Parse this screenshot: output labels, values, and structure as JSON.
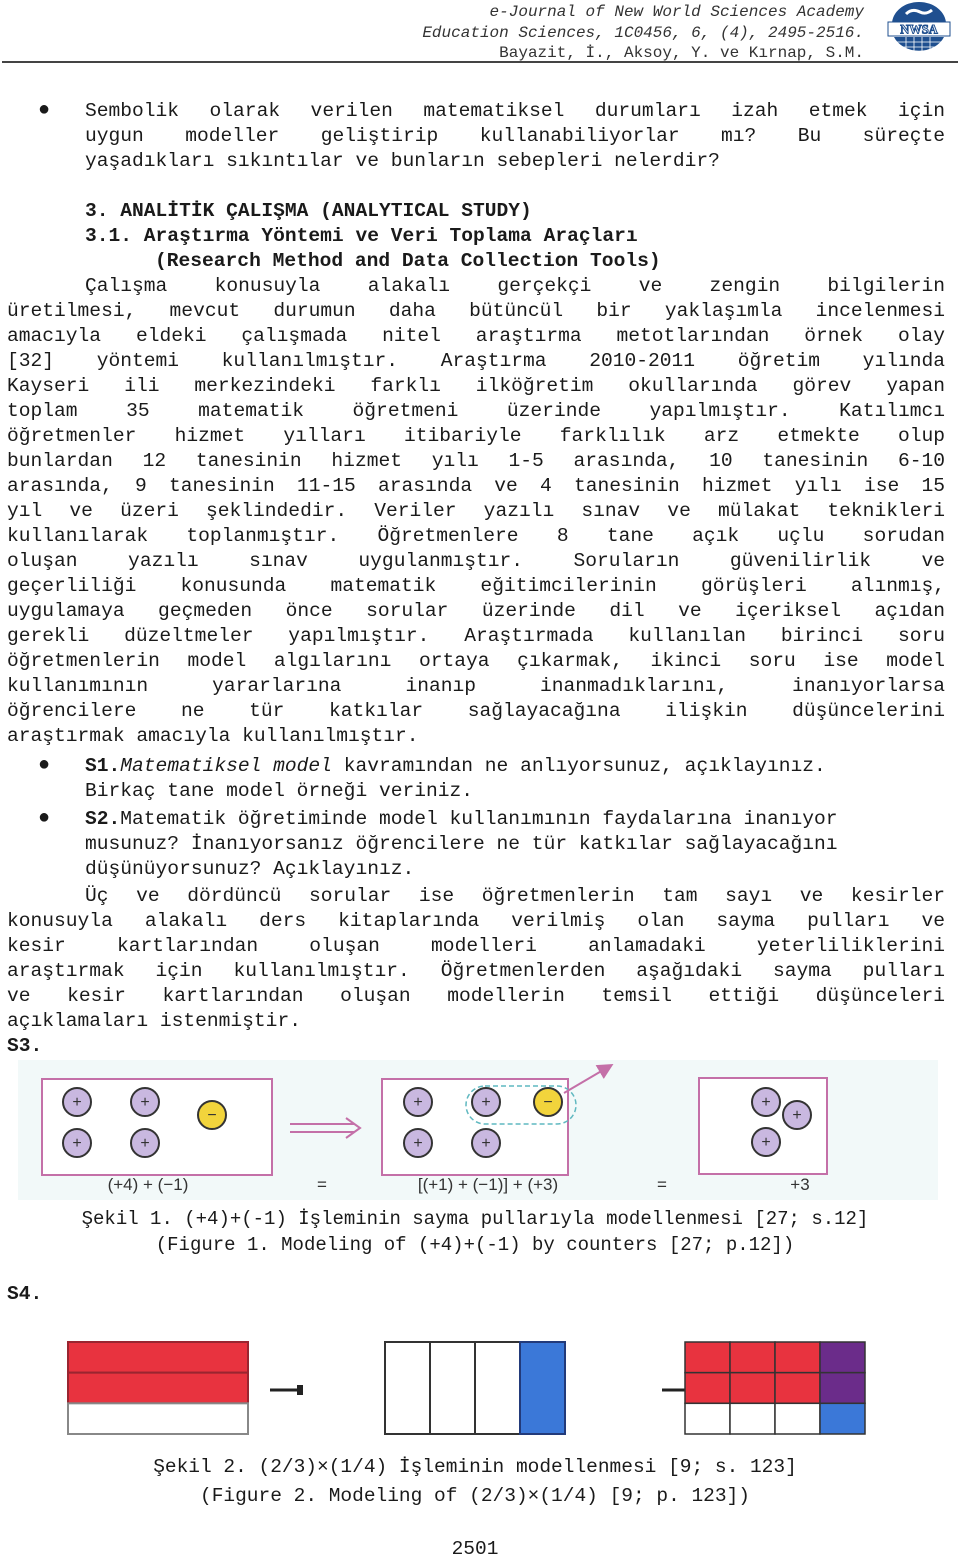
{
  "header": {
    "journal_line": "e-Journal of New World Sciences Academy",
    "citation_line": "Education Sciences, 1C0456, 6, (4), 2495-2516.",
    "authors_line": "Bayazit, İ., Aksoy, Y. ve Kırnap, S.M.",
    "logo_text": "NWSA",
    "logo_icon": "nwsa-globe-logo"
  },
  "intro_bullet": {
    "lines": [
      "Sembolik olarak verilen matematiksel durumları izah etmek için",
      "uygun modeller geliştirip kullanabiliyorlar mı? Bu süreçte",
      "yaşadıkları sıkıntılar ve bunların sebepleri nelerdir?"
    ]
  },
  "section": {
    "heading": "3. ANALİTİK ÇALIŞMA (ANALYTICAL STUDY)",
    "subheading": "3.1. Araştırma Yöntemi ve Veri Toplama Araçları",
    "subheading_en": "(Research Method and Data Collection Tools)"
  },
  "paragraph1": {
    "lines": [
      "Çalışma konusuyla alakalı gerçekçi ve zengin bilgilerin",
      "üretilmesi, mevcut durumun daha bütüncül bir yaklaşımla incelenmesi",
      "amacıyla eldeki çalışmada nitel araştırma metotlarından örnek olay",
      "[32] yöntemi kullanılmıştır. Araştırma 2010-2011 öğretim yılında",
      "Kayseri ili merkezindeki farklı ilköğretim okullarında görev yapan",
      "toplam 35 matematik öğretmeni üzerinde yapılmıştır. Katılımcı",
      "öğretmenler hizmet yılları itibariyle farklılık arz etmekte olup",
      "bunlardan 12 tanesinin hizmet yılı 1-5 arasında, 10 tanesinin 6-10",
      "arasında, 9 tanesinin 11-15 arasında ve 4 tanesinin hizmet yılı ise 15",
      "yıl ve üzeri şeklindedir. Veriler yazılı sınav ve mülakat teknikleri",
      "kullanılarak toplanmıştır. Öğretmenlere 8 tane açık uçlu sorudan",
      "oluşan yazılı sınav uygulanmıştır. Soruların güvenilirlik ve",
      "geçerliliği konusunda matematik eğitimcilerinin görüşleri alınmış,",
      "uygulamaya geçmeden önce sorular üzerinde dil ve içeriksel açıdan",
      "gerekli düzeltmeler yapılmıştır. Araştırmada kullanılan birinci soru",
      "öğretmenlerin model algılarını ortaya çıkarmak, ikinci soru ise model",
      "kullanımının yararlarına inanıp inanmadıklarını, inanıyorlarsa",
      "öğrencilere ne tür katkılar sağlayacağına ilişkin düşüncelerini",
      "araştırmak amacıyla kullanılmıştır."
    ]
  },
  "questions": [
    {
      "label": "S1.",
      "italic_part": "Matematiksel model",
      "rest_line1": " kavramından ne anlıyorsunuz, açıklayınız.",
      "line2": "Birkaç tane model örneği veriniz."
    },
    {
      "label": "S2.",
      "rest_line1": "Matematik öğretiminde model kullanımının faydalarına inanıyor",
      "line2": "musunuz? İnanıyorsanız öğrencilere ne tür katkılar sağlayacağını",
      "line3": "düşünüyorsunuz? Açıklayınız."
    }
  ],
  "paragraph2": {
    "lines": [
      "Üç ve dördüncü sorular ise öğretmenlerin tam sayı ve kesirler",
      "konusuyla alakalı ders kitaplarında verilmiş olan sayma pulları ve",
      "kesir kartlarından oluşan modelleri anlamadaki yeterliliklerini",
      "araştırmak için kullanılmıştır. Öğretmenlerden aşağıdaki sayma pulları",
      "ve kesir kartlarından oluşan modellerin temsil ettiği düşünceleri",
      "açıklamaları istenmiştir."
    ]
  },
  "s3_label": "S3.",
  "figure1": {
    "panel1_label": "(+4) + (−1)",
    "equals1": "=",
    "panel2_label": "[(+1) + (−1)] + (+3)",
    "equals2": "=",
    "panel3_label": "+3",
    "plus_symbol": "+",
    "minus_symbol": "−",
    "panel1": {
      "positive_counters": 4,
      "negative_counters": 1
    },
    "panel2": {
      "positive_counters": 4,
      "negative_counters": 1,
      "zero_pair_circled": 1
    },
    "panel3": {
      "positive_counters": 3,
      "negative_counters": 0
    },
    "colors": {
      "positive": "#c9b8e0",
      "negative": "#f2d43c",
      "frame": "#c470a8",
      "dashed": "#5fb8c0",
      "background": "#f2f9f9"
    },
    "caption_tr": "Şekil 1. (+4)+(-1) İşleminin sayma pullarıyla modellenmesi [27; s.12]",
    "caption_en": "(Figure 1. Modeling of (+4)+(-1) by counters [27; p.12])"
  },
  "s4_label": "S4.",
  "figure2": {
    "card1": {
      "fraction": "2/3",
      "shaded_rows": 2,
      "total_rows": 3
    },
    "card2": {
      "fraction": "1/4",
      "shaded_columns": 1,
      "total_columns": 4
    },
    "card3": {
      "fraction": "(2/3)x(1/4)",
      "rows": 3,
      "columns": 4,
      "overlap_cells": 2
    },
    "colors": {
      "red": "#e8333f",
      "blue": "#3b78d8",
      "purple": "#6b2c8a"
    },
    "caption_tr": "Şekil 2. (2/3)×(1/4) İşleminin modellenmesi [9; s. 123]",
    "caption_en": "(Figure 2. Modeling of (2/3)×(1/4) [9; p. 123])"
  },
  "page_number": "2501"
}
